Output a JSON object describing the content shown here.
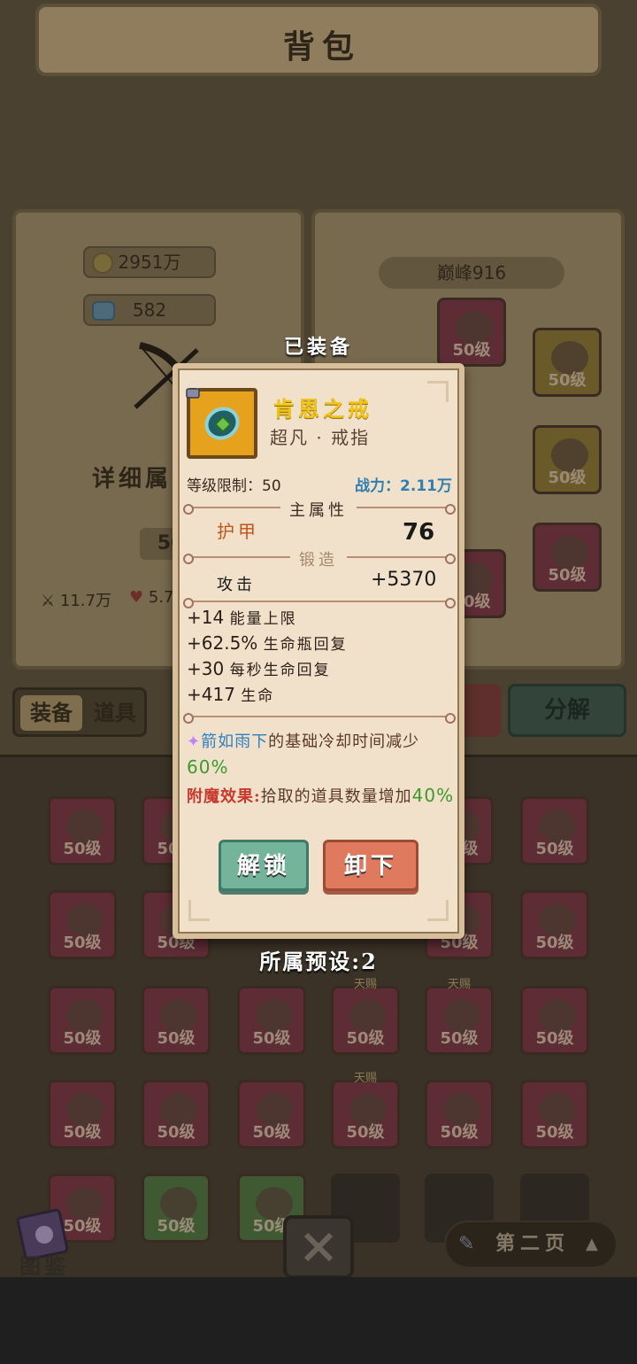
{
  "header": {
    "title": "背包"
  },
  "currency": {
    "gold": "2951万",
    "gems": "582"
  },
  "left_card": {
    "detail_label": "详细属",
    "level": "50",
    "attack_stat": "11.7万",
    "health_stat": "5.7"
  },
  "right_card": {
    "peak_label": "巅峰916"
  },
  "equipped_label": "已装备",
  "item": {
    "name": "肯恩之戒",
    "type": "超凡 · 戒指",
    "level_limit": "等级限制：50",
    "power": "战力：2.11万",
    "main_stat_title": "主属性",
    "main_stat_name": "护甲",
    "main_stat_value": "76",
    "forge_title": "锻造",
    "forge_stat_name": "攻击",
    "forge_stat_value": "+5370",
    "sub_stats": [
      {
        "value": "+14",
        "name": "能量上限"
      },
      {
        "value": "+62.5%",
        "name": "生命瓶回复"
      },
      {
        "value": "+30",
        "name": "每秒生命回复"
      },
      {
        "value": "+417",
        "name": "生命"
      }
    ],
    "skill_effect": {
      "icon": "✦",
      "skill": "箭如雨下",
      "text": "的基础冷却时间减少",
      "value": "60%"
    },
    "enchant_effect": {
      "label": "附魔效果:",
      "text": "拾取的道具数量增加",
      "value": "40%"
    },
    "unlock_label": "解锁",
    "unequip_label": "卸下"
  },
  "preset_label": "所属预设:2",
  "tabs": {
    "equipment": "装备",
    "items": "道具"
  },
  "decompose_label": "分解",
  "slots": {
    "level_label": "50级",
    "tag_label": "天赐"
  },
  "page_label": "第二页",
  "atlas_label": "图鉴",
  "colors": {
    "accent_gold": "#f0c419",
    "unlock_green": "#73b49b",
    "unequip_red": "#e07a5e",
    "power_blue": "#2f7fb0"
  }
}
